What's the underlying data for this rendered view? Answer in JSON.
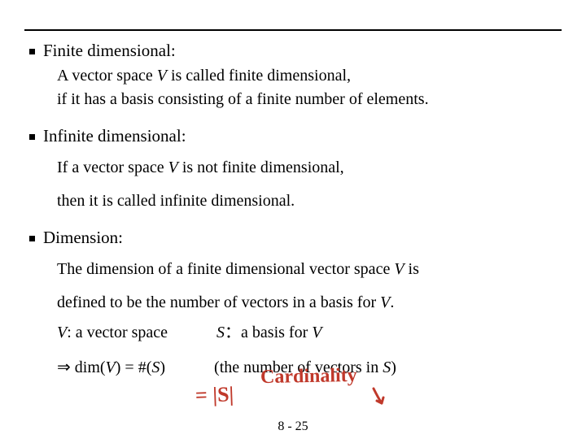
{
  "sections": {
    "finite": {
      "heading": "Finite dimensional:",
      "line1_a": "A vector space ",
      "line1_v": "V",
      "line1_b": "  is called finite dimensional,",
      "line2": "if it has a basis consisting of a finite number of elements."
    },
    "infinite": {
      "heading": "Infinite dimensional:",
      "line1_a": "If a vector space ",
      "line1_v": "V",
      "line1_b": "  is not finite dimensional,",
      "line2": "then it is called infinite dimensional."
    },
    "dimension": {
      "heading": "Dimension:",
      "line1_a": "The dimension of a finite dimensional vector space ",
      "line1_v": "V",
      "line1_b": "  is",
      "line2_a": "defined to be the number of vectors in a basis for ",
      "line2_v": "V",
      "line2_b": ".",
      "left_label_v": "V",
      "left_label_rest": ": a vector space",
      "right_label_s": "S",
      "right_label_rest": "：a basis for ",
      "right_label_v": "V",
      "concl_arrow": "⇒ ",
      "concl_a": "dim(",
      "concl_v": "V",
      "concl_b": ") = #(",
      "concl_s": "S",
      "concl_c": ")",
      "paren_a": "(the number of vectors in ",
      "paren_s": "S",
      "paren_b": ")"
    }
  },
  "handwriting": {
    "eq_s": "= |S|",
    "cardinality": "Cardinality"
  },
  "footer": "8 - 25"
}
